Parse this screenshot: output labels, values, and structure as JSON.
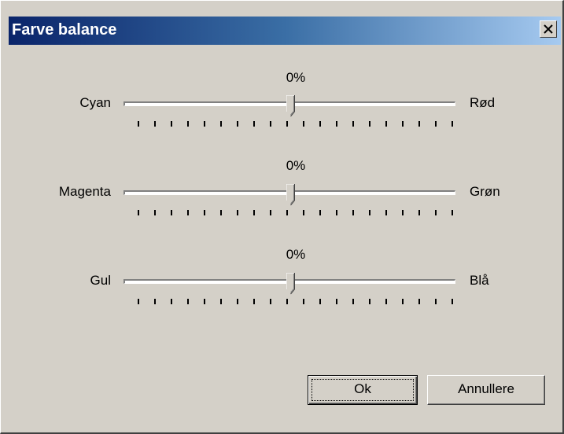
{
  "window": {
    "title": "Farve balance",
    "close_label": "X"
  },
  "sliders": [
    {
      "left_label": "Cyan",
      "right_label": "Rød",
      "value_text": "0%",
      "value": 0
    },
    {
      "left_label": "Magenta",
      "right_label": "Grøn",
      "value_text": "0%",
      "value": 0
    },
    {
      "left_label": "Gul",
      "right_label": "Blå",
      "value_text": "0%",
      "value": 0
    }
  ],
  "buttons": {
    "ok_label": "Ok",
    "cancel_label": "Annullere"
  },
  "colors": {
    "title_bar_start": "#0a246a",
    "title_bar_end": "#a6caf0",
    "dialog_face": "#d4d0c8"
  }
}
